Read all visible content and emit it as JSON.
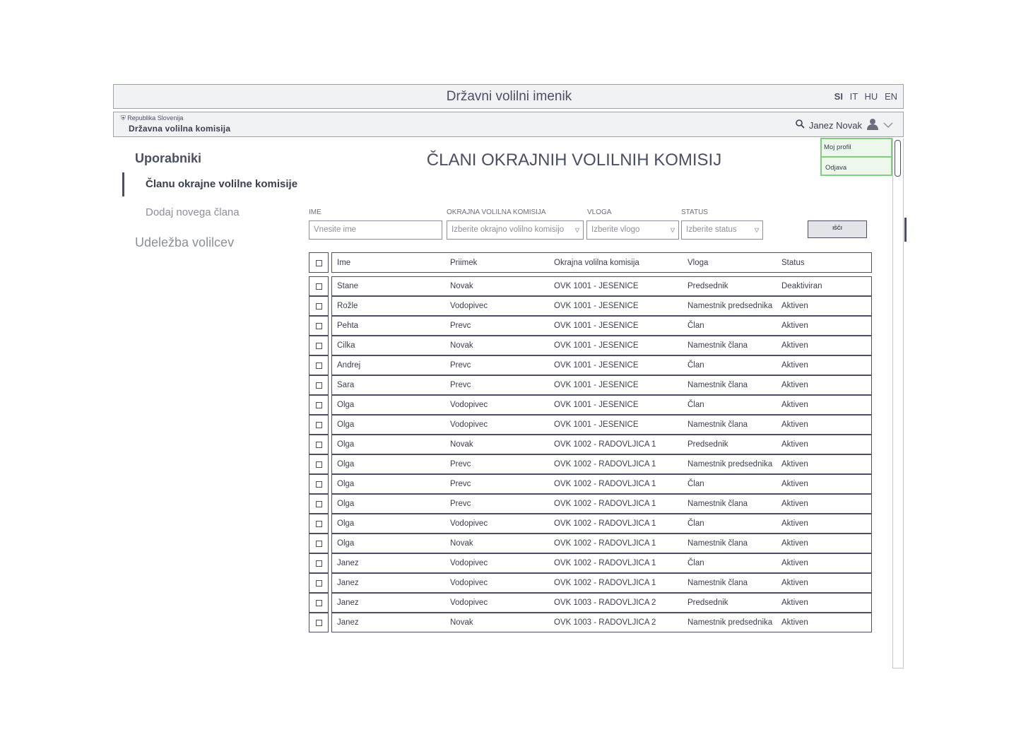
{
  "header": {
    "title": "Državni volilni imenik",
    "languages": [
      "SI",
      "IT",
      "HU",
      "EN"
    ]
  },
  "subheader": {
    "logo_small": "Republika Slovenija",
    "logo_big": "Državna volilna komisija",
    "user_name": "Janez Novak"
  },
  "user_menu": {
    "items": [
      "Moj profil",
      "Odjava"
    ]
  },
  "sidebar": {
    "title": "Uporabniki",
    "active_item": "Članu okrajne volilne komisije",
    "add_item": "Dodaj novega člana",
    "section2": "Udeležba volilcev"
  },
  "main": {
    "title": "ČLANI OKRAJNIH VOLILNIH KOMISIJ"
  },
  "filters": {
    "name_label": "IME",
    "name_placeholder": "Vnesite ime",
    "ovk_label": "OKRAJNA VOLILNA KOMISIJA",
    "ovk_placeholder": "Izberite okrajno volilno komisijo",
    "role_label": "VLOGA",
    "role_placeholder": "Izberite vlogo",
    "status_label": "STATUS",
    "status_placeholder": "Izberite status",
    "search_button": "IŠČI"
  },
  "table": {
    "columns": [
      "Ime",
      "Priimek",
      "Okrajna volilna komisija",
      "Vloga",
      "Status"
    ],
    "rows": [
      [
        "Stane",
        "Novak",
        "OVK 1001 - JESENICE",
        "Predsednik",
        "Deaktiviran"
      ],
      [
        "Rožle",
        "Vodopivec",
        "OVK 1001 - JESENICE",
        "Namestnik predsednika",
        "Aktiven"
      ],
      [
        "Pehta",
        "Prevc",
        "OVK 1001 - JESENICE",
        "Član",
        "Aktiven"
      ],
      [
        "Cilka",
        "Novak",
        "OVK 1001 - JESENICE",
        "Namestnik člana",
        "Aktiven"
      ],
      [
        "Andrej",
        "Prevc",
        "OVK 1001 - JESENICE",
        "Član",
        "Aktiven"
      ],
      [
        "Sara",
        "Prevc",
        "OVK 1001 - JESENICE",
        "Namestnik člana",
        "Aktiven"
      ],
      [
        "Olga",
        "Vodopivec",
        "OVK 1001 - JESENICE",
        "Član",
        "Aktiven"
      ],
      [
        "Olga",
        "Vodopivec",
        "OVK 1001 - JESENICE",
        "Namestnik člana",
        "Aktiven"
      ],
      [
        "Olga",
        "Novak",
        "OVK 1002 - RADOVLJICA 1",
        "Predsednik",
        "Aktiven"
      ],
      [
        "Olga",
        "Prevc",
        "OVK 1002 - RADOVLJICA 1",
        "Namestnik predsednika",
        "Aktiven"
      ],
      [
        "Olga",
        "Prevc",
        "OVK 1002 - RADOVLJICA 1",
        "Član",
        "Aktiven"
      ],
      [
        "Olga",
        "Prevc",
        "OVK 1002 - RADOVLJICA 1",
        "Namestnik člana",
        "Aktiven"
      ],
      [
        "Olga",
        "Vodopivec",
        "OVK 1002 - RADOVLJICA 1",
        "Član",
        "Aktiven"
      ],
      [
        "Olga",
        "Novak",
        "OVK 1002 - RADOVLJICA 1",
        "Namestnik člana",
        "Aktiven"
      ],
      [
        "Janez",
        "Vodopivec",
        "OVK 1002 - RADOVLJICA 1",
        "Član",
        "Aktiven"
      ],
      [
        "Janez",
        "Vodopivec",
        "OVK 1002 - RADOVLJICA 1",
        "Namestnik člana",
        "Aktiven"
      ],
      [
        "Janez",
        "Vodopivec",
        "OVK 1003 - RADOVLJICA 2",
        "Predsednik",
        "Aktiven"
      ],
      [
        "Janez",
        "Novak",
        "OVK 1003 - RADOVLJICA 2",
        "Namestnik predsednika",
        "Aktiven"
      ]
    ]
  }
}
